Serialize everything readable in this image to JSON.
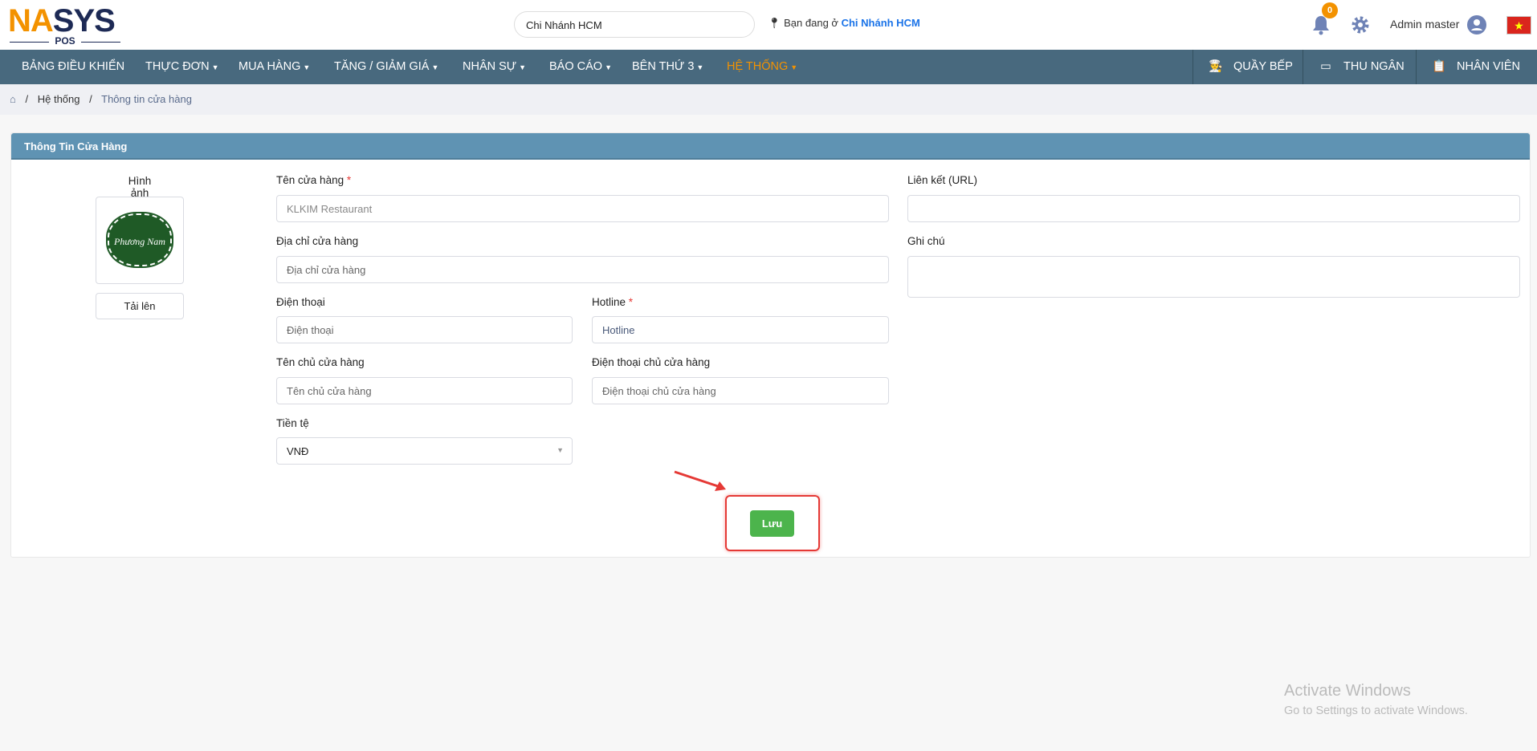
{
  "logo": {
    "brand_a": "NA",
    "brand_b": "SYS",
    "sub": "POS"
  },
  "header": {
    "branch_select": "Chi Nhánh HCM",
    "location_prefix": "Bạn đang ở",
    "location_branch": "Chi Nhánh HCM",
    "notification_count": "0",
    "user_name": "Admin master"
  },
  "nav": {
    "items": [
      {
        "label": "BẢNG ĐIỀU KHIỂN",
        "dropdown": false
      },
      {
        "label": "THỰC ĐƠN",
        "dropdown": true
      },
      {
        "label": "MUA HÀNG",
        "dropdown": true
      },
      {
        "label": "TĂNG / GIẢM GIÁ",
        "dropdown": true
      },
      {
        "label": "NHÂN SỰ",
        "dropdown": true
      },
      {
        "label": "BÁO CÁO",
        "dropdown": true
      },
      {
        "label": "BÊN THỨ 3",
        "dropdown": true
      },
      {
        "label": "HỆ THỐNG",
        "dropdown": true,
        "active": true
      }
    ],
    "right": [
      {
        "label": "QUẦY BẾP",
        "icon": "chef-icon"
      },
      {
        "label": "THU NGÂN",
        "icon": "cash-register-icon"
      },
      {
        "label": "NHÂN VIÊN",
        "icon": "clipboard-icon"
      }
    ]
  },
  "breadcrumb": {
    "parent": "Hệ thống",
    "current": "Thông tin cửa hàng"
  },
  "panel": {
    "title": "Thông Tin Cửa Hàng"
  },
  "form": {
    "image_label": "Hình ảnh",
    "upload_label": "Tải lên",
    "logo_text": "Phương Nam",
    "store_name": {
      "label": "Tên cửa hàng",
      "placeholder": "KLKIM Restaurant"
    },
    "address": {
      "label": "Địa chỉ cửa hàng",
      "placeholder": "Địa chỉ cửa hàng"
    },
    "phone": {
      "label": "Điện thoại",
      "placeholder": "Điện thoại"
    },
    "hotline": {
      "label": "Hotline",
      "placeholder": "Hotline"
    },
    "owner_name": {
      "label": "Tên chủ cửa hàng",
      "placeholder": "Tên chủ cửa hàng"
    },
    "owner_phone": {
      "label": "Điện thoại chủ cửa hàng",
      "placeholder": "Điện thoại chủ cửa hàng"
    },
    "currency": {
      "label": "Tiền tệ",
      "value": "VNĐ"
    },
    "url": {
      "label": "Liên kết (URL)",
      "value": ""
    },
    "note": {
      "label": "Ghi chú",
      "value": ""
    },
    "save_label": "Lưu"
  },
  "watermark": {
    "line1": "Activate Windows",
    "line2": "Go to Settings to activate Windows."
  },
  "colors": {
    "nav": "#48697e",
    "accent": "#f39200",
    "panel_header": "#5f93b3",
    "save": "#4cb44c",
    "highlight": "#e53935"
  }
}
